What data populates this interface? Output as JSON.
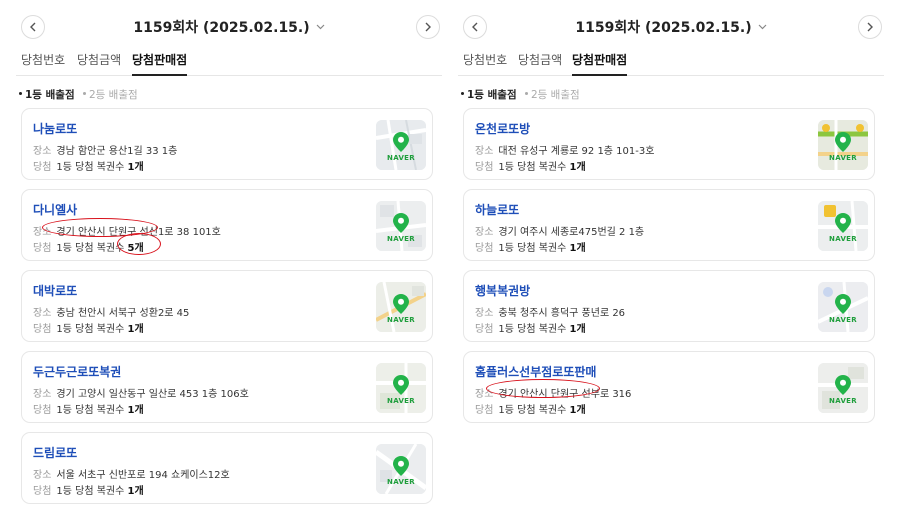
{
  "panels": [
    {
      "round": "1159회차 (2025.02.15.)",
      "tabs": [
        "당첨번호",
        "당첨금액",
        "당첨판매점"
      ],
      "active_tab": "당첨판매점",
      "subtabs": [
        "1등 배출점",
        "2등 배출점"
      ],
      "active_subtab": "1등 배출점",
      "labels": {
        "place": "장소",
        "win": "당첨"
      },
      "stores": [
        {
          "name": "나눔로또",
          "address": "경남 함안군 용산1길 33 1층",
          "win_text": "1등 당첨 복권수",
          "count": "1개",
          "map_label": "NAVER"
        },
        {
          "name": "다니엘사",
          "address": "경기 안산시 단원구 선신1로 38 101호",
          "win_text": "1등 당첨 복권수",
          "count": "5개",
          "map_label": "NAVER"
        },
        {
          "name": "대박로또",
          "address": "충남 천안시 서북구 성환2로 45",
          "win_text": "1등 당첨 복권수",
          "count": "1개",
          "map_label": "NAVER"
        },
        {
          "name": "두근두근로또복권",
          "address": "경기 고양시 일산동구 일산로 453 1층 106호",
          "win_text": "1등 당첨 복권수",
          "count": "1개",
          "map_label": "NAVER"
        },
        {
          "name": "드림로또",
          "address": "서울 서초구 신반포로 194 쇼케이스12호",
          "win_text": "1등 당첨 복권수",
          "count": "1개",
          "map_label": "NAVER"
        }
      ]
    },
    {
      "round": "1159회차 (2025.02.15.)",
      "tabs": [
        "당첨번호",
        "당첨금액",
        "당첨판매점"
      ],
      "active_tab": "당첨판매점",
      "subtabs": [
        "1등 배출점",
        "2등 배출점"
      ],
      "active_subtab": "1등 배출점",
      "labels": {
        "place": "장소",
        "win": "당첨"
      },
      "stores": [
        {
          "name": "온천로또방",
          "address": "대전 유성구 계룡로 92 1층 101-3호",
          "win_text": "1등 당첨 복권수",
          "count": "1개",
          "map_label": "NAVER"
        },
        {
          "name": "하늘로또",
          "address": "경기 여주시 세종로475번길 2 1층",
          "win_text": "1등 당첨 복권수",
          "count": "1개",
          "map_label": "NAVER"
        },
        {
          "name": "행복복권방",
          "address": "충북 청주시 흥덕구 풍년로 26",
          "win_text": "1등 당첨 복권수",
          "count": "1개",
          "map_label": "NAVER"
        },
        {
          "name": "홈플러스선부점로또판매",
          "address": "경기 안산시 단원구 선부로 316",
          "win_text": "1등 당첨 복권수",
          "count": "1개",
          "map_label": "NAVER"
        }
      ]
    }
  ],
  "colors": {
    "store_name": "#1e4eb8",
    "naver_green": "#1f9e3c",
    "annotation_red": "#d8111b"
  }
}
